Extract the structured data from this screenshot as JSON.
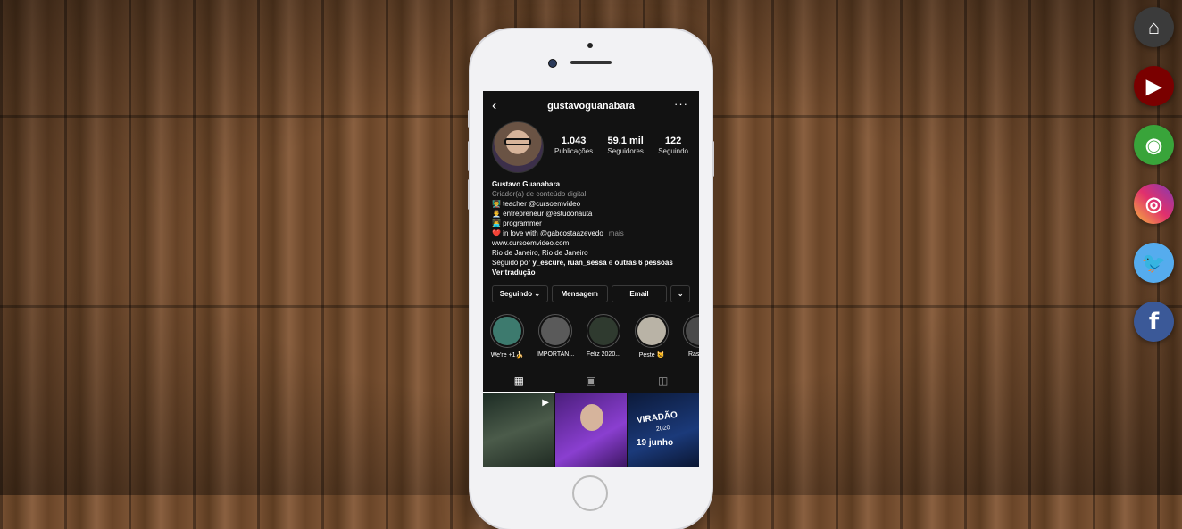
{
  "profile": {
    "username": "gustavoguanabara",
    "stats": [
      {
        "value": "1.043",
        "label": "Publicações"
      },
      {
        "value": "59,1 mil",
        "label": "Seguidores"
      },
      {
        "value": "122",
        "label": "Seguindo"
      }
    ],
    "name": "Gustavo Guanabara",
    "category": "Criador(a) de conteúdo digital",
    "bio_lines": [
      "👨‍🏫 teacher @cursoemvideo",
      "👨‍💼 entrepreneur @estudonauta",
      "👨‍💻 programmer",
      "❤️ in love with @gabcostaazevedo"
    ],
    "more_label": "mais",
    "website": "www.cursoemvideo.com",
    "location": "Rio de Janeiro, Rio de Janeiro",
    "followed_by_prefix": "Seguido por ",
    "followed_by_names": "y_escure, ruan_sessa",
    "followed_by_mid": " e ",
    "followed_by_more": "outras 6 pessoas",
    "translate_label": "Ver tradução"
  },
  "actions": {
    "following": "Seguindo ⌄",
    "message": "Mensagem",
    "email": "Email",
    "dropdown": "⌄"
  },
  "highlights": [
    {
      "label": "We're +1🍌",
      "color": "#3d7a6e"
    },
    {
      "label": "IMPORTAN...",
      "color": "#5a5a5a"
    },
    {
      "label": "Feliz 2020...",
      "color": "#2f3a2f"
    },
    {
      "label": "Peste 😺",
      "color": "#b9b3a6"
    },
    {
      "label": "Raspb...",
      "color": "#4a4a4a"
    }
  ],
  "posts": [
    {
      "overlay": "▶"
    },
    {
      "overlay": ""
    },
    {
      "title": "VIRADÃO",
      "year": "2020",
      "date": "19 junho"
    }
  ],
  "social": [
    {
      "name": "home-icon",
      "glyph": "⌂"
    },
    {
      "name": "youtube-icon",
      "glyph": "▶"
    },
    {
      "name": "github-icon",
      "glyph": "◉"
    },
    {
      "name": "instagram-icon",
      "glyph": "◎"
    },
    {
      "name": "twitter-icon",
      "glyph": "🐦"
    },
    {
      "name": "facebook-icon",
      "glyph": "f"
    }
  ]
}
